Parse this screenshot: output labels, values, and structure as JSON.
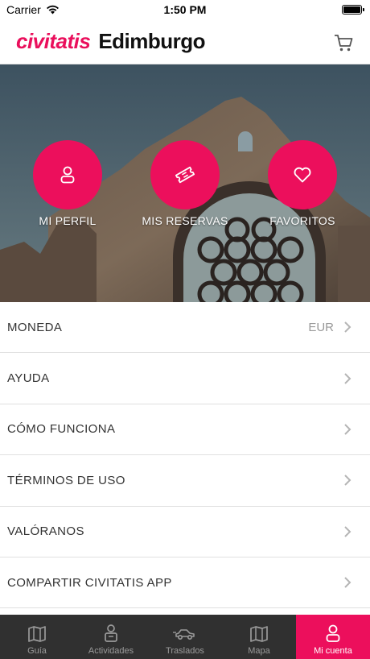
{
  "status_bar": {
    "carrier": "Carrier",
    "time": "1:50 PM"
  },
  "header": {
    "brand": "civitatis",
    "city": "Edimburgo"
  },
  "hero": {
    "actions": [
      {
        "label": "MI PERFIL",
        "icon": "user-icon"
      },
      {
        "label": "MIS RESERVAS",
        "icon": "ticket-icon"
      },
      {
        "label": "FAVORITOS",
        "icon": "heart-icon"
      }
    ]
  },
  "menu": [
    {
      "label": "MONEDA",
      "value": "EUR"
    },
    {
      "label": "AYUDA",
      "value": ""
    },
    {
      "label": "CÓMO FUNCIONA",
      "value": ""
    },
    {
      "label": "TÉRMINOS DE USO",
      "value": ""
    },
    {
      "label": "VALÓRANOS",
      "value": ""
    },
    {
      "label": "COMPARTIR CIVITATIS APP",
      "value": ""
    }
  ],
  "tabs": [
    {
      "label": "Guía",
      "icon": "guide-map-icon"
    },
    {
      "label": "Actividades",
      "icon": "activities-icon"
    },
    {
      "label": "Traslados",
      "icon": "transfer-car-icon"
    },
    {
      "label": "Mapa",
      "icon": "map-icon"
    },
    {
      "label": "Mi cuenta",
      "icon": "user-icon"
    }
  ],
  "colors": {
    "brand": "#ec0f5c",
    "tab_bar": "#303030"
  }
}
